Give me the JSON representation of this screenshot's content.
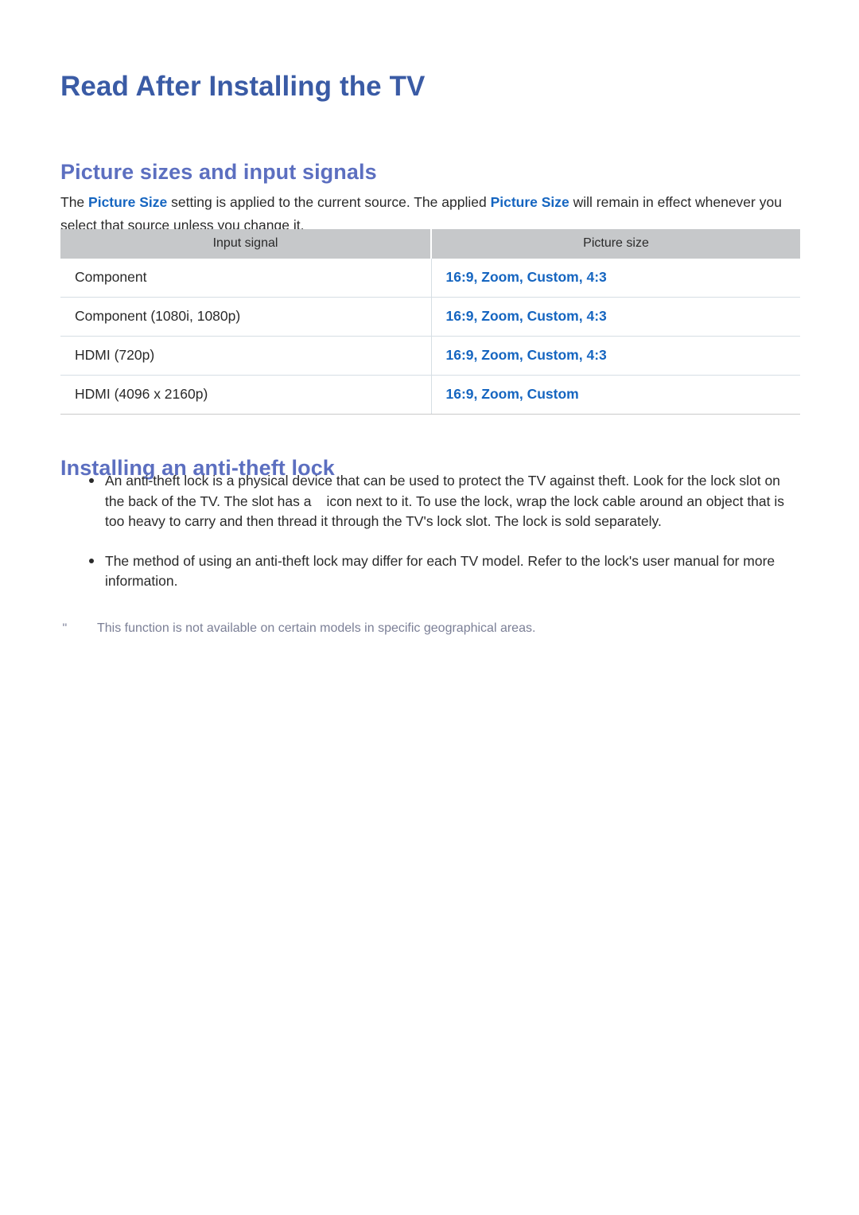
{
  "document": {
    "title": "Read After Installing the TV"
  },
  "colors": {
    "title_blue": "#3a5ba5",
    "section_blue": "#5c6fc0",
    "link_blue": "#1565c0",
    "body_text": "#2a2a2a",
    "table_header_bg": "#c6c8ca",
    "table_border": "#d6dee4",
    "footnote_text": "#7b7f96"
  },
  "sections": [
    {
      "heading": "Picture sizes and input signals",
      "intro": {
        "part1": "The ",
        "link1": "Picture Size",
        "part2": " setting is applied to the current source. The applied ",
        "link2": "Picture Size",
        "part3": " will remain in effect whenever you select that source unless you change it."
      },
      "table": {
        "headers": [
          "Input signal",
          "Picture size"
        ],
        "rows": [
          {
            "signal": "Component",
            "sizes": "16:9, Zoom, Custom, 4:3"
          },
          {
            "signal": "Component (1080i, 1080p)",
            "sizes": "16:9, Zoom, Custom, 4:3"
          },
          {
            "signal": "HDMI (720p)",
            "sizes": "16:9, Zoom, Custom, 4:3"
          },
          {
            "signal": "HDMI (4096 x 2160p)",
            "sizes": "16:9, Zoom, Custom"
          }
        ]
      }
    },
    {
      "heading": "Installing an anti-theft lock",
      "bullets": [
        {
          "text_before_icon": "An anti-theft lock is a physical device that can be used to protect the TV against theft. Look for the lock slot on the back of the TV. The slot has a",
          "text_after_icon": "icon next to it. To use the lock, wrap the lock cable around an object that is too heavy to carry and then thread it through the TV's lock slot. The lock is sold separately."
        },
        {
          "text": "The method of using an anti-theft lock may differ for each TV model. Refer to the lock's user manual for more information."
        }
      ],
      "footnote": {
        "mark": "\"",
        "text": "This function is not available on certain models in specific geographical areas."
      }
    }
  ]
}
